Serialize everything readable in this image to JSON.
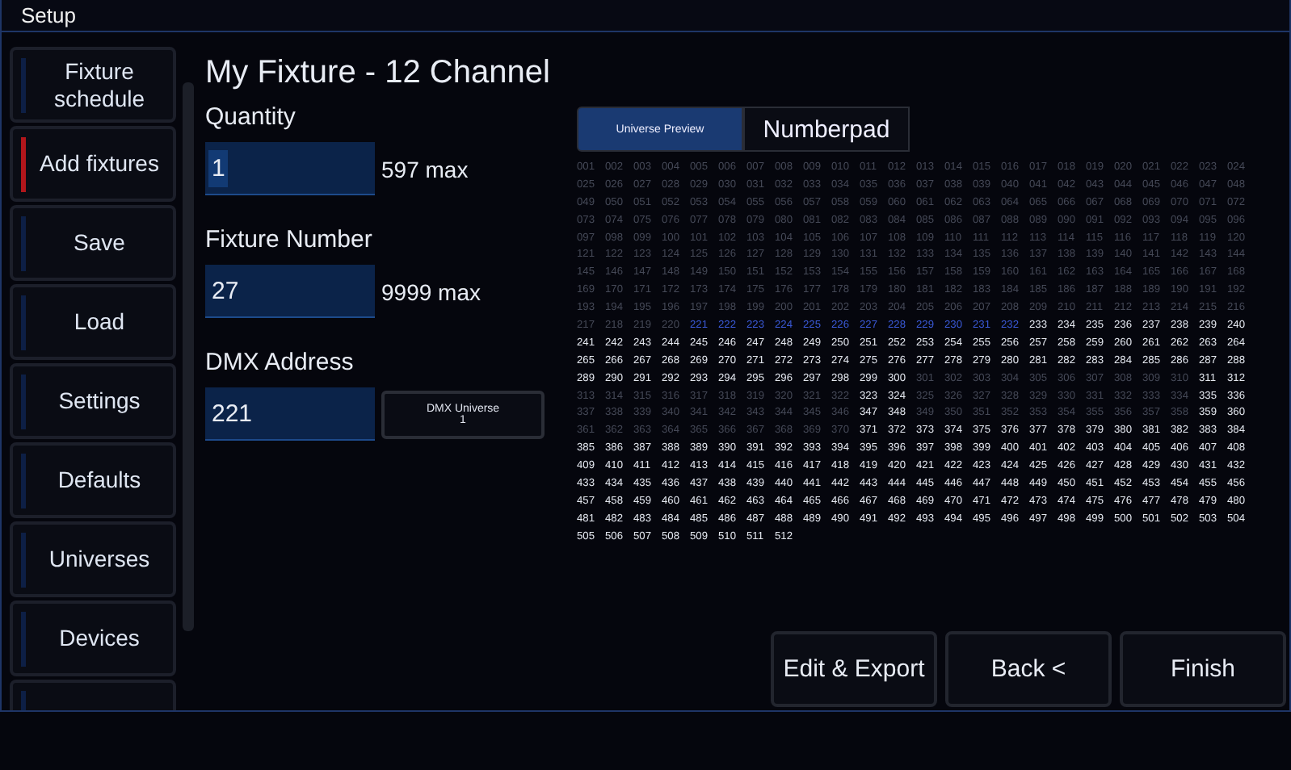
{
  "window": {
    "title": "Setup"
  },
  "sidebar": {
    "items": [
      {
        "label": "Fixture schedule",
        "selected": false
      },
      {
        "label": "Add fixtures",
        "selected": true
      },
      {
        "label": "Save",
        "selected": false
      },
      {
        "label": "Load",
        "selected": false
      },
      {
        "label": "Settings",
        "selected": false
      },
      {
        "label": "Defaults",
        "selected": false
      },
      {
        "label": "Universes",
        "selected": false
      },
      {
        "label": "Devices",
        "selected": false
      },
      {
        "selected": false
      }
    ]
  },
  "heading": "My Fixture - 12 Channel",
  "fields": [
    {
      "label": "Quantity",
      "value": "1",
      "hint": "597 max"
    },
    {
      "label": "Fixture Number",
      "value": "27",
      "hint": "9999 max"
    },
    {
      "label": "DMX Address",
      "value": "221",
      "universe_button": [
        "DMX Universe",
        "1"
      ]
    }
  ],
  "tabs": [
    {
      "label": "Universe Preview",
      "selected": true
    },
    {
      "label": "Numberpad",
      "selected": false
    }
  ],
  "universe": {
    "rows": [
      {
        "cells": [
          "001",
          "002",
          "003",
          "004",
          "005",
          "006",
          "007",
          "008",
          "009",
          "010",
          "011",
          "012",
          "013",
          "014",
          "015",
          "016",
          "017",
          "018",
          "019",
          "020",
          "021",
          "022",
          "023",
          "024"
        ],
        "used": [
          true,
          true,
          true,
          true,
          true,
          true,
          true,
          true,
          true,
          true,
          true,
          true,
          true,
          true,
          true,
          true,
          true,
          true,
          true,
          true,
          true,
          true,
          true,
          true
        ],
        "selected": [
          false,
          false,
          false,
          false,
          false,
          false,
          false,
          false,
          false,
          false,
          false,
          false,
          false,
          false,
          false,
          false,
          false,
          false,
          false,
          false,
          false,
          false,
          false,
          false
        ]
      },
      {
        "cells": [
          "025",
          "026",
          "027",
          "028",
          "029",
          "030",
          "031",
          "032",
          "033",
          "034",
          "035",
          "036",
          "037",
          "038",
          "039",
          "040",
          "041",
          "042",
          "043",
          "044",
          "045",
          "046",
          "047",
          "048"
        ],
        "used": [
          true,
          true,
          true,
          true,
          true,
          true,
          true,
          true,
          true,
          true,
          true,
          true,
          true,
          true,
          true,
          true,
          true,
          true,
          true,
          true,
          true,
          true,
          true,
          true
        ],
        "selected": [
          false,
          false,
          false,
          false,
          false,
          false,
          false,
          false,
          false,
          false,
          false,
          false,
          false,
          false,
          false,
          false,
          false,
          false,
          false,
          false,
          false,
          false,
          false,
          false
        ]
      },
      {
        "cells": [
          "049",
          "050",
          "051",
          "052",
          "053",
          "054",
          "055",
          "056",
          "057",
          "058",
          "059",
          "060",
          "061",
          "062",
          "063",
          "064",
          "065",
          "066",
          "067",
          "068",
          "069",
          "070",
          "071",
          "072"
        ],
        "used": [
          true,
          true,
          true,
          true,
          true,
          true,
          true,
          true,
          true,
          true,
          true,
          true,
          true,
          true,
          true,
          true,
          true,
          true,
          true,
          true,
          true,
          true,
          true,
          true
        ],
        "selected": [
          false,
          false,
          false,
          false,
          false,
          false,
          false,
          false,
          false,
          false,
          false,
          false,
          false,
          false,
          false,
          false,
          false,
          false,
          false,
          false,
          false,
          false,
          false,
          false
        ]
      },
      {
        "cells": [
          "073",
          "074",
          "075",
          "076",
          "077",
          "078",
          "079",
          "080",
          "081",
          "082",
          "083",
          "084",
          "085",
          "086",
          "087",
          "088",
          "089",
          "090",
          "091",
          "092",
          "093",
          "094",
          "095",
          "096"
        ],
        "used": [
          true,
          true,
          true,
          true,
          true,
          true,
          true,
          true,
          true,
          true,
          true,
          true,
          true,
          true,
          true,
          true,
          true,
          true,
          true,
          true,
          true,
          true,
          true,
          true
        ],
        "selected": [
          false,
          false,
          false,
          false,
          false,
          false,
          false,
          false,
          false,
          false,
          false,
          false,
          false,
          false,
          false,
          false,
          false,
          false,
          false,
          false,
          false,
          false,
          false,
          false
        ]
      },
      {
        "cells": [
          "097",
          "098",
          "099",
          "100",
          "101",
          "102",
          "103",
          "104",
          "105",
          "106",
          "107",
          "108",
          "109",
          "110",
          "111",
          "112",
          "113",
          "114",
          "115",
          "116",
          "117",
          "118",
          "119",
          "120"
        ],
        "used": [
          true,
          true,
          true,
          true,
          true,
          true,
          true,
          true,
          true,
          true,
          true,
          true,
          true,
          true,
          true,
          true,
          true,
          true,
          true,
          true,
          true,
          true,
          true,
          true
        ],
        "selected": [
          false,
          false,
          false,
          false,
          false,
          false,
          false,
          false,
          false,
          false,
          false,
          false,
          false,
          false,
          false,
          false,
          false,
          false,
          false,
          false,
          false,
          false,
          false,
          false
        ]
      },
      {
        "cells": [
          "121",
          "122",
          "123",
          "124",
          "125",
          "126",
          "127",
          "128",
          "129",
          "130",
          "131",
          "132",
          "133",
          "134",
          "135",
          "136",
          "137",
          "138",
          "139",
          "140",
          "141",
          "142",
          "143",
          "144"
        ],
        "used": [
          true,
          true,
          true,
          true,
          true,
          true,
          true,
          true,
          true,
          true,
          true,
          true,
          true,
          true,
          true,
          true,
          true,
          true,
          true,
          true,
          true,
          true,
          true,
          true
        ],
        "selected": [
          false,
          false,
          false,
          false,
          false,
          false,
          false,
          false,
          false,
          false,
          false,
          false,
          false,
          false,
          false,
          false,
          false,
          false,
          false,
          false,
          false,
          false,
          false,
          false
        ]
      },
      {
        "cells": [
          "145",
          "146",
          "147",
          "148",
          "149",
          "150",
          "151",
          "152",
          "153",
          "154",
          "155",
          "156",
          "157",
          "158",
          "159",
          "160",
          "161",
          "162",
          "163",
          "164",
          "165",
          "166",
          "167",
          "168"
        ],
        "used": [
          true,
          true,
          true,
          true,
          true,
          true,
          true,
          true,
          true,
          true,
          true,
          true,
          true,
          true,
          true,
          true,
          true,
          true,
          true,
          true,
          true,
          true,
          true,
          true
        ],
        "selected": [
          false,
          false,
          false,
          false,
          false,
          false,
          false,
          false,
          false,
          false,
          false,
          false,
          false,
          false,
          false,
          false,
          false,
          false,
          false,
          false,
          false,
          false,
          false,
          false
        ]
      },
      {
        "cells": [
          "169",
          "170",
          "171",
          "172",
          "173",
          "174",
          "175",
          "176",
          "177",
          "178",
          "179",
          "180",
          "181",
          "182",
          "183",
          "184",
          "185",
          "186",
          "187",
          "188",
          "189",
          "190",
          "191",
          "192"
        ],
        "used": [
          true,
          true,
          true,
          true,
          true,
          true,
          true,
          true,
          true,
          true,
          true,
          true,
          true,
          true,
          true,
          true,
          true,
          true,
          true,
          true,
          true,
          true,
          true,
          true
        ],
        "selected": [
          false,
          false,
          false,
          false,
          false,
          false,
          false,
          false,
          false,
          false,
          false,
          false,
          false,
          false,
          false,
          false,
          false,
          false,
          false,
          false,
          false,
          false,
          false,
          false
        ]
      },
      {
        "cells": [
          "193",
          "194",
          "195",
          "196",
          "197",
          "198",
          "199",
          "200",
          "201",
          "202",
          "203",
          "204",
          "205",
          "206",
          "207",
          "208",
          "209",
          "210",
          "211",
          "212",
          "213",
          "214",
          "215",
          "216"
        ],
        "used": [
          true,
          true,
          true,
          true,
          true,
          true,
          true,
          true,
          true,
          true,
          true,
          true,
          true,
          true,
          true,
          true,
          true,
          true,
          true,
          true,
          true,
          true,
          true,
          true
        ],
        "selected": [
          false,
          false,
          false,
          false,
          false,
          false,
          false,
          false,
          false,
          false,
          false,
          false,
          false,
          false,
          false,
          false,
          false,
          false,
          false,
          false,
          false,
          false,
          false,
          false
        ]
      },
      {
        "cells": [
          "217",
          "218",
          "219",
          "220",
          "221",
          "222",
          "223",
          "224",
          "225",
          "226",
          "227",
          "228",
          "229",
          "230",
          "231",
          "232",
          "233",
          "234",
          "235",
          "236",
          "237",
          "238",
          "239",
          "240"
        ],
        "used": [
          true,
          true,
          true,
          true,
          false,
          false,
          false,
          false,
          false,
          false,
          false,
          false,
          false,
          false,
          false,
          false,
          false,
          false,
          false,
          false,
          false,
          false,
          false,
          false
        ],
        "selected": [
          false,
          false,
          false,
          false,
          true,
          true,
          true,
          true,
          true,
          true,
          true,
          true,
          true,
          true,
          true,
          true,
          false,
          false,
          false,
          false,
          false,
          false,
          false,
          false
        ]
      },
      {
        "cells": [
          "241",
          "242",
          "243",
          "244",
          "245",
          "246",
          "247",
          "248",
          "249",
          "250",
          "251",
          "252",
          "253",
          "254",
          "255",
          "256",
          "257",
          "258",
          "259",
          "260",
          "261",
          "262",
          "263",
          "264"
        ],
        "used": [
          false,
          false,
          false,
          false,
          false,
          false,
          false,
          false,
          false,
          false,
          false,
          false,
          false,
          false,
          false,
          false,
          false,
          false,
          false,
          false,
          false,
          false,
          false,
          false
        ],
        "selected": [
          false,
          false,
          false,
          false,
          false,
          false,
          false,
          false,
          false,
          false,
          false,
          false,
          false,
          false,
          false,
          false,
          false,
          false,
          false,
          false,
          false,
          false,
          false,
          false
        ]
      },
      {
        "cells": [
          "265",
          "266",
          "267",
          "268",
          "269",
          "270",
          "271",
          "272",
          "273",
          "274",
          "275",
          "276",
          "277",
          "278",
          "279",
          "280",
          "281",
          "282",
          "283",
          "284",
          "285",
          "286",
          "287",
          "288"
        ],
        "used": [
          false,
          false,
          false,
          false,
          false,
          false,
          false,
          false,
          false,
          false,
          false,
          false,
          false,
          false,
          false,
          false,
          false,
          false,
          false,
          false,
          false,
          false,
          false,
          false
        ],
        "selected": [
          false,
          false,
          false,
          false,
          false,
          false,
          false,
          false,
          false,
          false,
          false,
          false,
          false,
          false,
          false,
          false,
          false,
          false,
          false,
          false,
          false,
          false,
          false,
          false
        ]
      },
      {
        "cells": [
          "289",
          "290",
          "291",
          "292",
          "293",
          "294",
          "295",
          "296",
          "297",
          "298",
          "299",
          "300",
          "301",
          "302",
          "303",
          "304",
          "305",
          "306",
          "307",
          "308",
          "309",
          "310",
          "311",
          "312"
        ],
        "used": [
          false,
          false,
          false,
          false,
          false,
          false,
          false,
          false,
          false,
          false,
          false,
          false,
          true,
          true,
          true,
          true,
          true,
          true,
          true,
          true,
          true,
          true,
          false,
          false
        ],
        "selected": [
          false,
          false,
          false,
          false,
          false,
          false,
          false,
          false,
          false,
          false,
          false,
          false,
          false,
          false,
          false,
          false,
          false,
          false,
          false,
          false,
          false,
          false,
          false,
          false
        ]
      },
      {
        "cells": [
          "313",
          "314",
          "315",
          "316",
          "317",
          "318",
          "319",
          "320",
          "321",
          "322",
          "323",
          "324",
          "325",
          "326",
          "327",
          "328",
          "329",
          "330",
          "331",
          "332",
          "333",
          "334",
          "335",
          "336"
        ],
        "used": [
          true,
          true,
          true,
          true,
          true,
          true,
          true,
          true,
          true,
          true,
          false,
          false,
          true,
          true,
          true,
          true,
          true,
          true,
          true,
          true,
          true,
          true,
          false,
          false
        ],
        "selected": [
          false,
          false,
          false,
          false,
          false,
          false,
          false,
          false,
          false,
          false,
          false,
          false,
          false,
          false,
          false,
          false,
          false,
          false,
          false,
          false,
          false,
          false,
          false,
          false
        ]
      },
      {
        "cells": [
          "337",
          "338",
          "339",
          "340",
          "341",
          "342",
          "343",
          "344",
          "345",
          "346",
          "347",
          "348",
          "349",
          "350",
          "351",
          "352",
          "353",
          "354",
          "355",
          "356",
          "357",
          "358",
          "359",
          "360"
        ],
        "used": [
          true,
          true,
          true,
          true,
          true,
          true,
          true,
          true,
          true,
          true,
          false,
          false,
          true,
          true,
          true,
          true,
          true,
          true,
          true,
          true,
          true,
          true,
          false,
          false
        ],
        "selected": [
          false,
          false,
          false,
          false,
          false,
          false,
          false,
          false,
          false,
          false,
          false,
          false,
          false,
          false,
          false,
          false,
          false,
          false,
          false,
          false,
          false,
          false,
          false,
          false
        ]
      },
      {
        "cells": [
          "361",
          "362",
          "363",
          "364",
          "365",
          "366",
          "367",
          "368",
          "369",
          "370",
          "371",
          "372",
          "373",
          "374",
          "375",
          "376",
          "377",
          "378",
          "379",
          "380",
          "381",
          "382",
          "383",
          "384"
        ],
        "used": [
          true,
          true,
          true,
          true,
          true,
          true,
          true,
          true,
          true,
          true,
          false,
          false,
          false,
          false,
          false,
          false,
          false,
          false,
          false,
          false,
          false,
          false,
          false,
          false
        ],
        "selected": [
          false,
          false,
          false,
          false,
          false,
          false,
          false,
          false,
          false,
          false,
          false,
          false,
          false,
          false,
          false,
          false,
          false,
          false,
          false,
          false,
          false,
          false,
          false,
          false
        ]
      },
      {
        "cells": [
          "385",
          "386",
          "387",
          "388",
          "389",
          "390",
          "391",
          "392",
          "393",
          "394",
          "395",
          "396",
          "397",
          "398",
          "399",
          "400",
          "401",
          "402",
          "403",
          "404",
          "405",
          "406",
          "407",
          "408"
        ],
        "used": [
          false,
          false,
          false,
          false,
          false,
          false,
          false,
          false,
          false,
          false,
          false,
          false,
          false,
          false,
          false,
          false,
          false,
          false,
          false,
          false,
          false,
          false,
          false,
          false
        ],
        "selected": [
          false,
          false,
          false,
          false,
          false,
          false,
          false,
          false,
          false,
          false,
          false,
          false,
          false,
          false,
          false,
          false,
          false,
          false,
          false,
          false,
          false,
          false,
          false,
          false
        ]
      },
      {
        "cells": [
          "409",
          "410",
          "411",
          "412",
          "413",
          "414",
          "415",
          "416",
          "417",
          "418",
          "419",
          "420",
          "421",
          "422",
          "423",
          "424",
          "425",
          "426",
          "427",
          "428",
          "429",
          "430",
          "431",
          "432"
        ],
        "used": [
          false,
          false,
          false,
          false,
          false,
          false,
          false,
          false,
          false,
          false,
          false,
          false,
          false,
          false,
          false,
          false,
          false,
          false,
          false,
          false,
          false,
          false,
          false,
          false
        ],
        "selected": [
          false,
          false,
          false,
          false,
          false,
          false,
          false,
          false,
          false,
          false,
          false,
          false,
          false,
          false,
          false,
          false,
          false,
          false,
          false,
          false,
          false,
          false,
          false,
          false
        ]
      },
      {
        "cells": [
          "433",
          "434",
          "435",
          "436",
          "437",
          "438",
          "439",
          "440",
          "441",
          "442",
          "443",
          "444",
          "445",
          "446",
          "447",
          "448",
          "449",
          "450",
          "451",
          "452",
          "453",
          "454",
          "455",
          "456"
        ],
        "used": [
          false,
          false,
          false,
          false,
          false,
          false,
          false,
          false,
          false,
          false,
          false,
          false,
          false,
          false,
          false,
          false,
          false,
          false,
          false,
          false,
          false,
          false,
          false,
          false
        ],
        "selected": [
          false,
          false,
          false,
          false,
          false,
          false,
          false,
          false,
          false,
          false,
          false,
          false,
          false,
          false,
          false,
          false,
          false,
          false,
          false,
          false,
          false,
          false,
          false,
          false
        ]
      },
      {
        "cells": [
          "457",
          "458",
          "459",
          "460",
          "461",
          "462",
          "463",
          "464",
          "465",
          "466",
          "467",
          "468",
          "469",
          "470",
          "471",
          "472",
          "473",
          "474",
          "475",
          "476",
          "477",
          "478",
          "479",
          "480"
        ],
        "used": [
          false,
          false,
          false,
          false,
          false,
          false,
          false,
          false,
          false,
          false,
          false,
          false,
          false,
          false,
          false,
          false,
          false,
          false,
          false,
          false,
          false,
          false,
          false,
          false
        ],
        "selected": [
          false,
          false,
          false,
          false,
          false,
          false,
          false,
          false,
          false,
          false,
          false,
          false,
          false,
          false,
          false,
          false,
          false,
          false,
          false,
          false,
          false,
          false,
          false,
          false
        ]
      },
      {
        "cells": [
          "481",
          "482",
          "483",
          "484",
          "485",
          "486",
          "487",
          "488",
          "489",
          "490",
          "491",
          "492",
          "493",
          "494",
          "495",
          "496",
          "497",
          "498",
          "499",
          "500",
          "501",
          "502",
          "503",
          "504"
        ],
        "used": [
          false,
          false,
          false,
          false,
          false,
          false,
          false,
          false,
          false,
          false,
          false,
          false,
          false,
          false,
          false,
          false,
          false,
          false,
          false,
          false,
          false,
          false,
          false,
          false
        ],
        "selected": [
          false,
          false,
          false,
          false,
          false,
          false,
          false,
          false,
          false,
          false,
          false,
          false,
          false,
          false,
          false,
          false,
          false,
          false,
          false,
          false,
          false,
          false,
          false,
          false
        ]
      },
      {
        "cells": [
          "505",
          "506",
          "507",
          "508",
          "509",
          "510",
          "511",
          "512"
        ],
        "used": [
          false,
          false,
          false,
          false,
          false,
          false,
          false,
          false
        ],
        "selected": [
          false,
          false,
          false,
          false,
          false,
          false,
          false,
          false
        ]
      }
    ]
  },
  "buttons": [
    "Edit & Export",
    "Back <",
    "Finish"
  ]
}
